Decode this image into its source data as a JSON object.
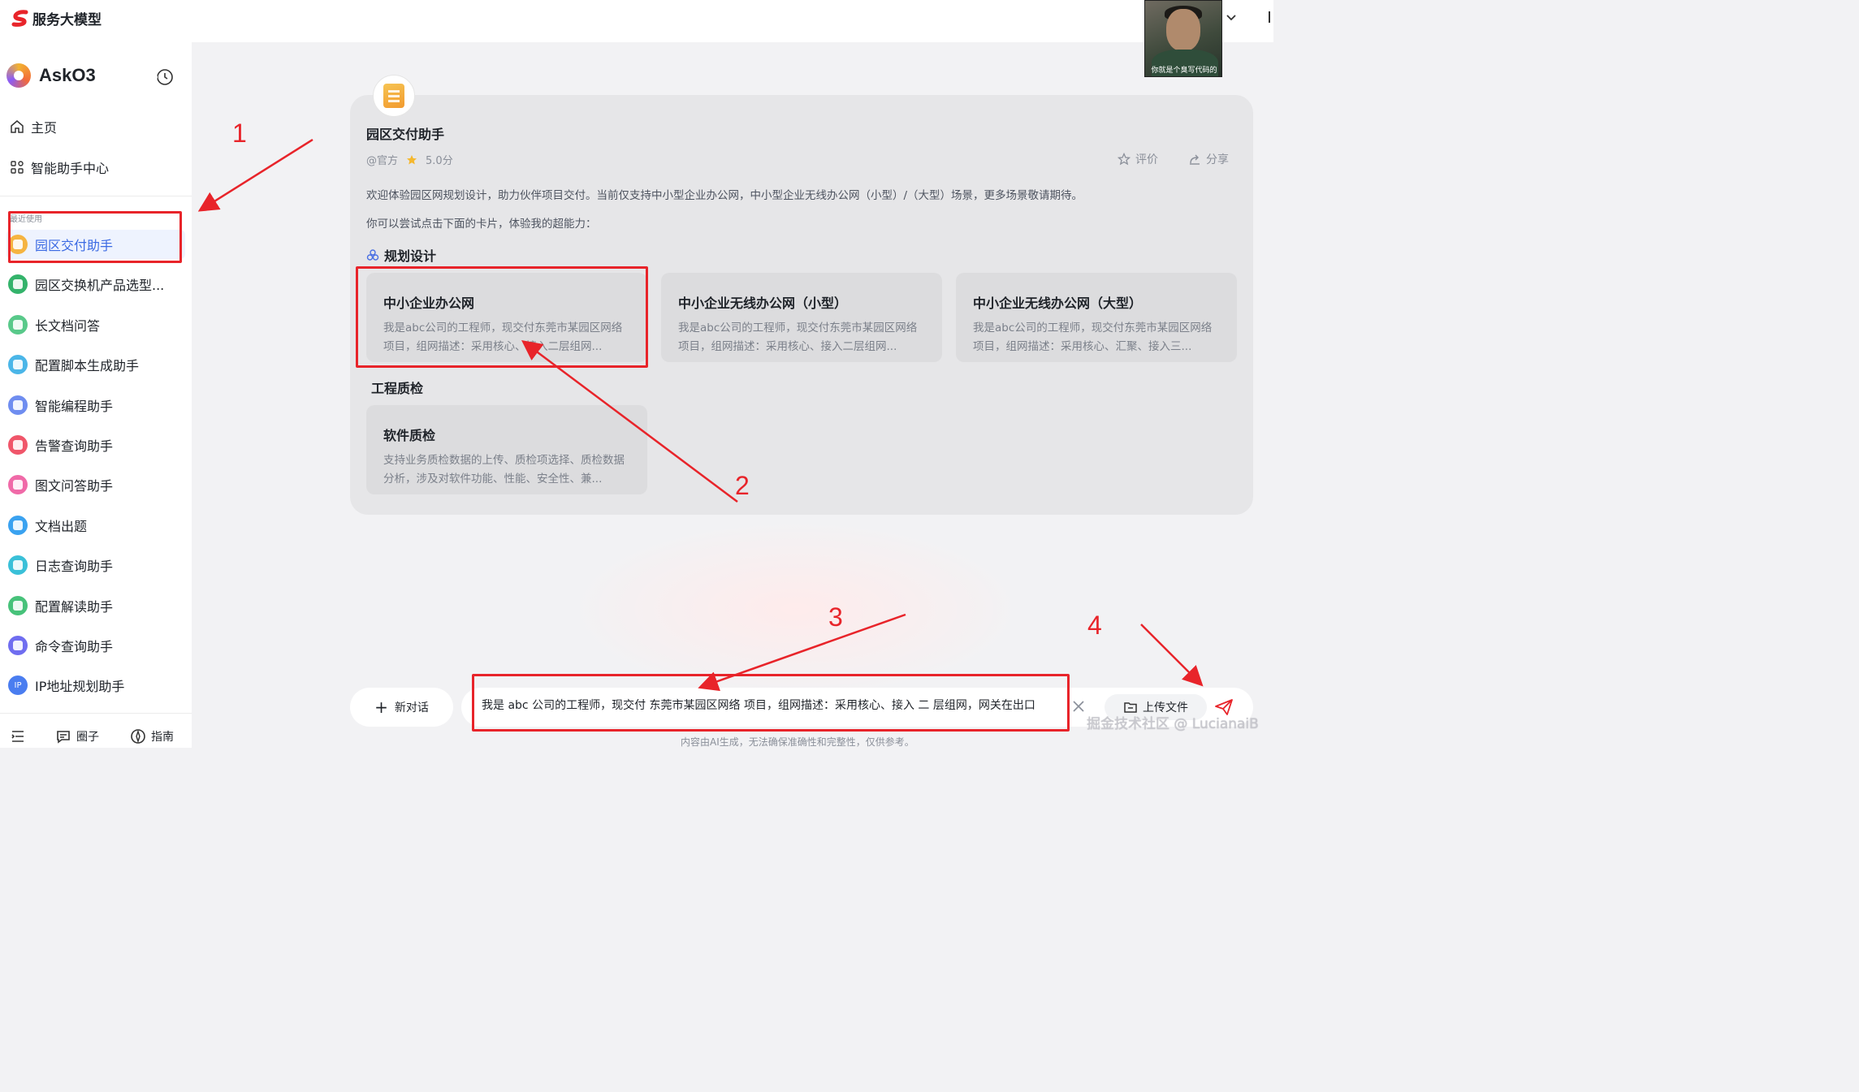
{
  "brand": {
    "name": "服务大模型"
  },
  "webcam": {
    "caption": "你就是个臭写代码的"
  },
  "sidebar": {
    "app_name": "AskO3",
    "nav": [
      {
        "label": "主页",
        "icon": "home-icon"
      },
      {
        "label": "智能助手中心",
        "icon": "grid-icon"
      }
    ],
    "recent_label": "最近使用",
    "assistants": [
      {
        "label": "园区交付助手",
        "color": "#f5b441",
        "active": true
      },
      {
        "label": "园区交换机产品选型...",
        "color": "#34b36b"
      },
      {
        "label": "长文档问答",
        "color": "#59c98a"
      },
      {
        "label": "配置脚本生成助手",
        "color": "#4bb6e8"
      },
      {
        "label": "智能编程助手",
        "color": "#6f8df0"
      },
      {
        "label": "告警查询助手",
        "color": "#f0566a"
      },
      {
        "label": "图文问答助手",
        "color": "#f06aa8"
      },
      {
        "label": "文档出题",
        "color": "#3aa2f0"
      },
      {
        "label": "日志查询助手",
        "color": "#3ac0d8"
      },
      {
        "label": "配置解读助手",
        "color": "#47c27a"
      },
      {
        "label": "命令查询助手",
        "color": "#6f6df0"
      },
      {
        "label": "IP地址规划助手",
        "color": "#4a7df0",
        "glyph": "IP"
      }
    ],
    "footer": [
      {
        "label": "",
        "icon": "menu-icon"
      },
      {
        "label": "圈子",
        "icon": "chat-bubble-icon"
      },
      {
        "label": "指南",
        "icon": "compass-icon"
      }
    ]
  },
  "assistant": {
    "name": "园区交付助手",
    "source": "@官方",
    "score": "5.0分",
    "rate_label": "评价",
    "share_label": "分享",
    "welcome": "欢迎体验园区网规划设计，助力伙伴项目交付。当前仅支持中小型企业办公网，中小型企业无线办公网（小型）/（大型）场景，更多场景敬请期待。",
    "try_hint": "你可以尝试点击下面的卡片，体验我的超能力："
  },
  "sections": [
    {
      "title": "规划设计",
      "cards": [
        {
          "title": "中小企业办公网",
          "desc": "我是abc公司的工程师，现交付东莞市某园区网络项目，组网描述：采用核心、接入二层组网..."
        },
        {
          "title": "中小企业无线办公网（小型）",
          "desc": "我是abc公司的工程师，现交付东莞市某园区网络项目，组网描述：采用核心、接入二层组网..."
        },
        {
          "title": "中小企业无线办公网（大型）",
          "desc": "我是abc公司的工程师，现交付东莞市某园区网络项目，组网描述：采用核心、汇聚、接入三..."
        }
      ]
    },
    {
      "title": "工程质检",
      "cards": [
        {
          "title": "软件质检",
          "desc": "支持业务质检数据的上传、质检项选择、质检数据分析，涉及对软件功能、性能、安全性、兼..."
        }
      ]
    }
  ],
  "composer": {
    "new_chat_label": "新对话",
    "input_value": "我是 abc 公司的工程师，现交付 东莞市某园区网络 项目，组网描述：采用核心、接入 二 层组网，网关在出口",
    "upload_label": "上传文件",
    "disclaimer": "内容由AI生成，无法确保准确性和完整性，仅供参考。"
  },
  "annotations": {
    "numbers": [
      "1",
      "2",
      "3",
      "4"
    ],
    "color": "#e8242a"
  },
  "watermark": "掘金技术社区 @ LucianaiB"
}
